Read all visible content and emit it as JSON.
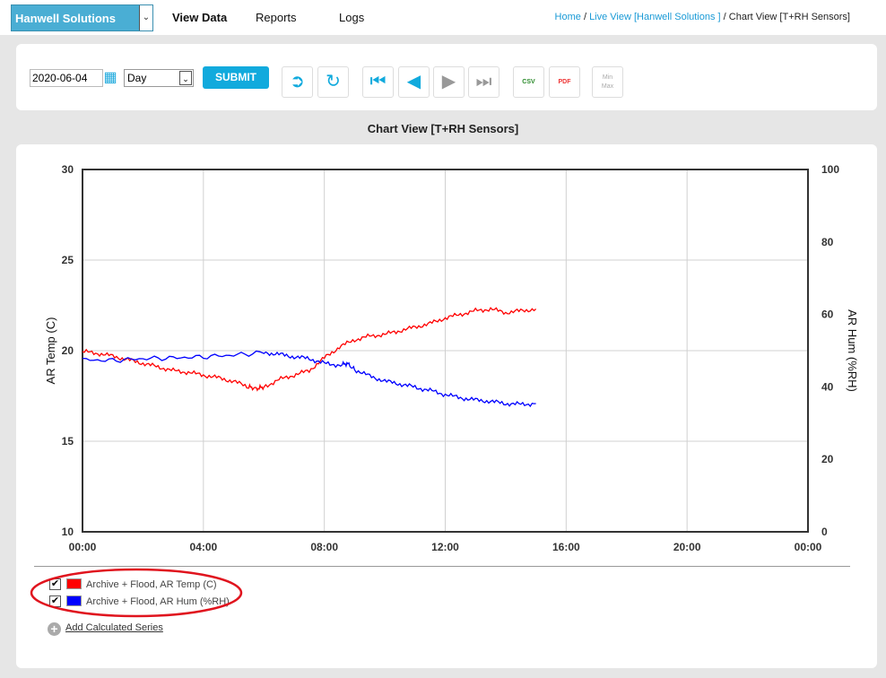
{
  "header": {
    "brand": "Hanwell Solutions",
    "nav": [
      "View Data",
      "Reports",
      "Logs"
    ],
    "breadcrumb": {
      "home": "Home",
      "live": "Live View [Hanwell Solutions ]",
      "current": "Chart View [T+RH Sensors]"
    }
  },
  "toolbar": {
    "date": "2020-06-04",
    "period": "Day",
    "submit": "SUBMIT",
    "csv": "CSV",
    "pdf": "PDF",
    "minmax_top": "Min",
    "minmax_bottom": "Max"
  },
  "chart_title": "Chart View [T+RH Sensors]",
  "chart_data": {
    "type": "line",
    "x_ticks": [
      "00:00",
      "04:00",
      "08:00",
      "12:00",
      "16:00",
      "20:00",
      "00:00"
    ],
    "xlim_hours": [
      0,
      24
    ],
    "left_axis": {
      "label": "AR Temp (C)",
      "ylim": [
        10,
        30
      ],
      "ticks": [
        "10",
        "15",
        "20",
        "25",
        "30"
      ]
    },
    "right_axis": {
      "label": "AR Hum (%RH)",
      "ylim": [
        0,
        100
      ],
      "ticks": [
        "0",
        "20",
        "40",
        "60",
        "80",
        "100"
      ]
    },
    "grid": true,
    "series": [
      {
        "name": "Archive + Flood, AR Temp (C)",
        "color": "#ff0000",
        "axis": "left",
        "x": [
          0,
          0.5,
          1,
          1.5,
          2,
          2.5,
          3,
          3.5,
          4,
          4.5,
          5,
          5.5,
          5.75,
          6,
          6.5,
          7,
          7.5,
          8,
          8.5,
          9,
          9.5,
          10,
          10.5,
          11,
          11.5,
          12,
          12.5,
          13,
          13.5,
          14,
          14.5,
          15
        ],
        "y": [
          19.95,
          19.85,
          19.7,
          19.5,
          19.3,
          19.1,
          18.9,
          18.8,
          18.65,
          18.5,
          18.3,
          18.0,
          17.9,
          18.0,
          18.4,
          18.65,
          18.9,
          19.6,
          20.2,
          20.6,
          20.8,
          20.9,
          21.1,
          21.3,
          21.5,
          21.8,
          22.0,
          22.2,
          22.3,
          22.1,
          22.2,
          22.3
        ]
      },
      {
        "name": "Archive + Flood, AR Hum (%RH)",
        "color": "#0000ff",
        "axis": "right",
        "x": [
          0,
          1,
          2,
          3,
          4,
          5,
          6,
          6.5,
          7,
          7.5,
          8,
          8.5,
          8.75,
          9,
          9.5,
          10,
          10.5,
          11,
          11.5,
          12,
          12.5,
          13,
          13.5,
          14,
          14.5,
          15
        ],
        "y": [
          47.5,
          47.3,
          47.8,
          48.0,
          48.3,
          48.8,
          49.5,
          49.0,
          48.3,
          47.8,
          46.5,
          46.0,
          46.5,
          44.8,
          43.0,
          41.6,
          40.8,
          39.9,
          39.0,
          37.9,
          37.0,
          36.4,
          36.0,
          35.4,
          35.2,
          35.4
        ]
      }
    ]
  },
  "legend": {
    "items": [
      {
        "label": "Archive + Flood, AR Temp (C)",
        "color": "#ff0000",
        "checked": true
      },
      {
        "label": "Archive + Flood, AR Hum (%RH)",
        "color": "#0000ff",
        "checked": true
      }
    ],
    "add_series": "Add Calculated Series"
  }
}
